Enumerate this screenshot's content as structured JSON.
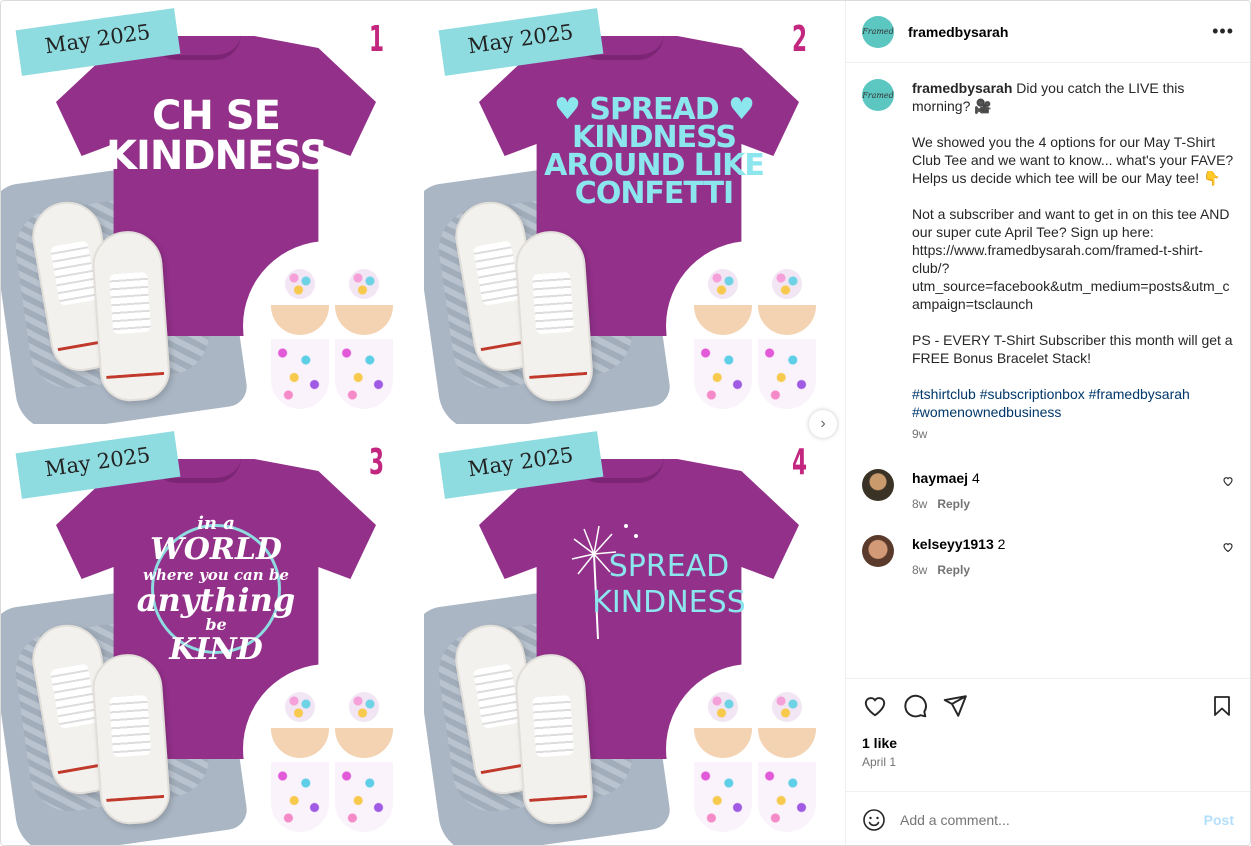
{
  "post": {
    "username": "framedbysarah",
    "logo_text": "Framed",
    "tiles": [
      {
        "tag": "May 2025",
        "number": "1",
        "design_lines": [
          "CH  SE",
          "KINDNESS"
        ]
      },
      {
        "tag": "May 2025",
        "number": "2",
        "design_lines": [
          "♥ SPREAD ♥",
          "KINDNESS",
          "AROUND LIKE",
          "CONFETTI"
        ]
      },
      {
        "tag": "May 2025",
        "number": "3",
        "design_lines": [
          "in a",
          "WORLD",
          "where you can be",
          "anything",
          "be",
          "KIND"
        ]
      },
      {
        "tag": "May 2025",
        "number": "4",
        "design_lines": [
          "SPREAD",
          "KINDNESS"
        ]
      }
    ],
    "caption_text": "Did you catch the LIVE this morning? 🎥\n\nWe showed you the 4 options for our May T-Shirt Club Tee and we want to know... what's your FAVE? Helps us decide which tee will be our May tee! 👇\n\nNot a subscriber and want to get in on this tee AND our super cute April Tee? Sign up here: https://www.framedbysarah.com/framed-t-shirt-club/?utm_source=facebook&utm_medium=posts&utm_campaign=tsclaunch\n\nPS - EVERY T-Shirt Subscriber this month will get a FREE Bonus Bracelet Stack!\n\n",
    "hashtags": "#tshirtclub #subscriptionbox #framedbysarah #womenownedbusiness",
    "caption_time": "9w",
    "comments": [
      {
        "user": "haymaej",
        "text": "4",
        "time": "8w",
        "reply": "Reply"
      },
      {
        "user": "kelseyy1913",
        "text": "2",
        "time": "8w",
        "reply": "Reply"
      }
    ],
    "likes": "1 like",
    "date": "April 1",
    "comment_placeholder": "Add a comment...",
    "post_label": "Post",
    "more_label": "•••"
  }
}
